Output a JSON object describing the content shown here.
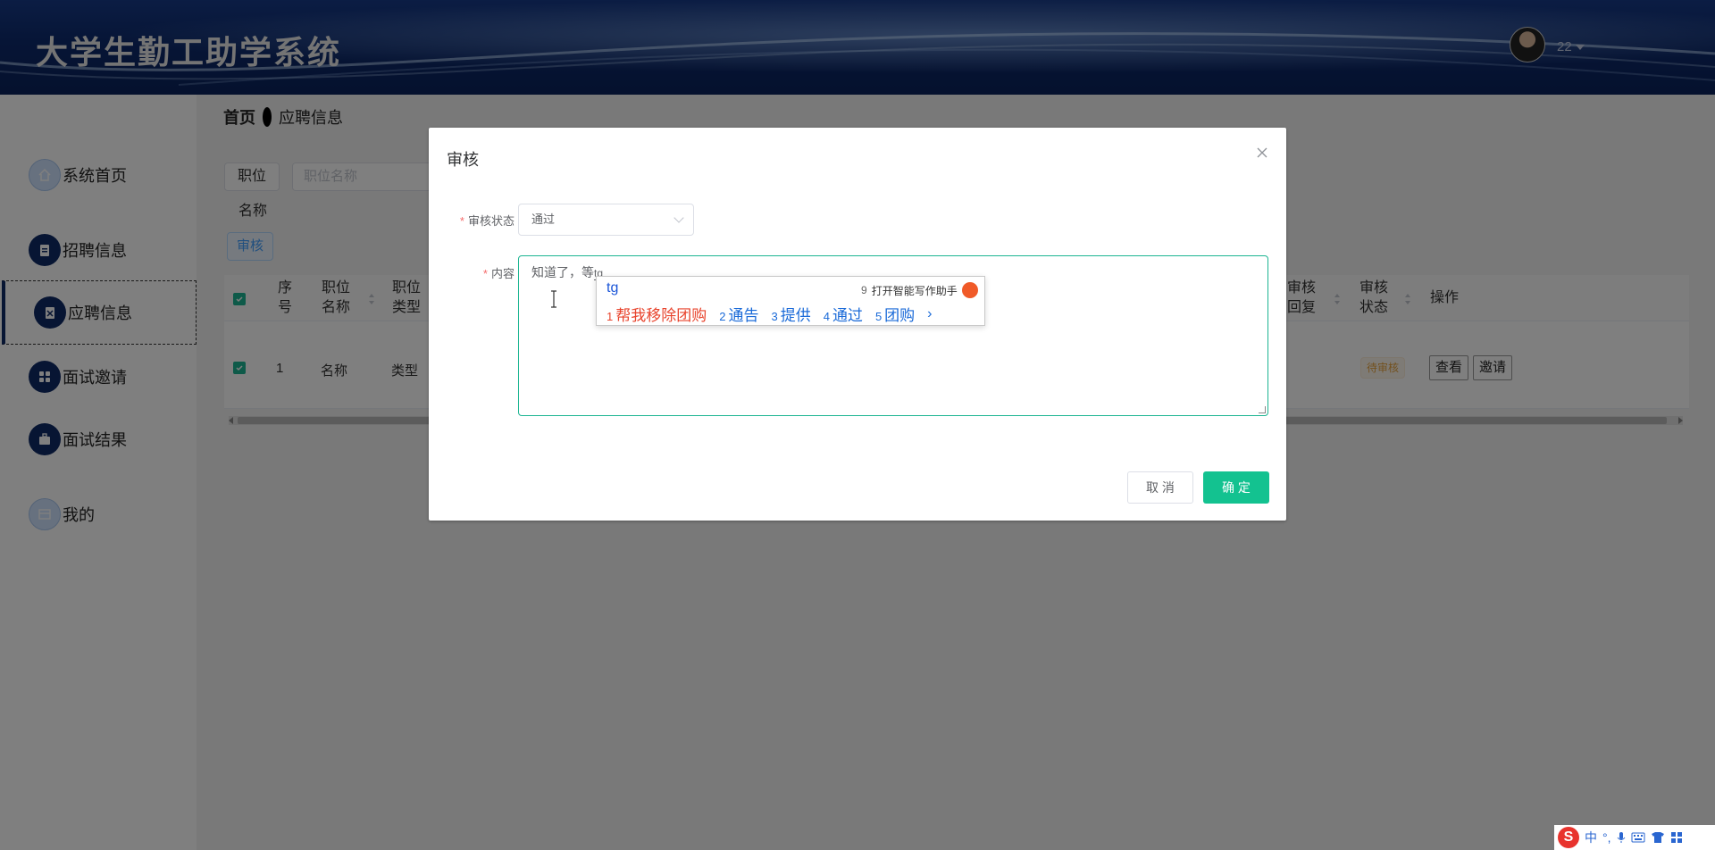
{
  "header": {
    "app_title": "大学生勤工助学系统",
    "username": "22"
  },
  "sidebar": {
    "items": [
      {
        "label": "系统首页",
        "icon": "home-icon"
      },
      {
        "label": "招聘信息",
        "icon": "clipboard-icon"
      },
      {
        "label": "应聘信息",
        "icon": "clipboard-icon"
      },
      {
        "label": "面试邀请",
        "icon": "grid-icon"
      },
      {
        "label": "面试结果",
        "icon": "briefcase-icon"
      },
      {
        "label": "我的",
        "icon": "window-icon"
      }
    ]
  },
  "breadcrumb": {
    "home": "首页",
    "current": "应聘信息"
  },
  "filter": {
    "label": "职位",
    "label_line2": "名称",
    "placeholder": "职位名称"
  },
  "toolbar": {
    "audit_label": "审核"
  },
  "table": {
    "headers": {
      "index": "序号",
      "position_name": "职位名称",
      "position_type": "职位类型",
      "audit_reply": "审核回复",
      "audit_status": "审核状态",
      "actions": "操作"
    },
    "rows": [
      {
        "index": "1",
        "position_name": "名称",
        "position_type": "类型",
        "audit_status": "待审核",
        "view_label": "查看",
        "invite_label": "邀请"
      }
    ]
  },
  "dialog": {
    "title": "审核",
    "status_label": "审核状态",
    "status_value": "通过",
    "content_label": "内容",
    "content_text": "知道了，等",
    "ime_inline": "tg",
    "cancel_label": "取 消",
    "confirm_label": "确 定"
  },
  "ime": {
    "composition": "tg",
    "ai_hint_num": "9",
    "ai_hint": "打开智能写作助手",
    "candidates": [
      {
        "num": "1",
        "text": "帮我移除团购"
      },
      {
        "num": "2",
        "text": "通告"
      },
      {
        "num": "3",
        "text": "提供"
      },
      {
        "num": "4",
        "text": "通过"
      },
      {
        "num": "5",
        "text": "团购"
      }
    ],
    "next": "›"
  },
  "tray": {
    "ime_mode": "中",
    "punct": "°,"
  },
  "colors": {
    "header_bg": "#0d2a6c",
    "accent": "#13c290",
    "pending": "#e6a23c"
  }
}
